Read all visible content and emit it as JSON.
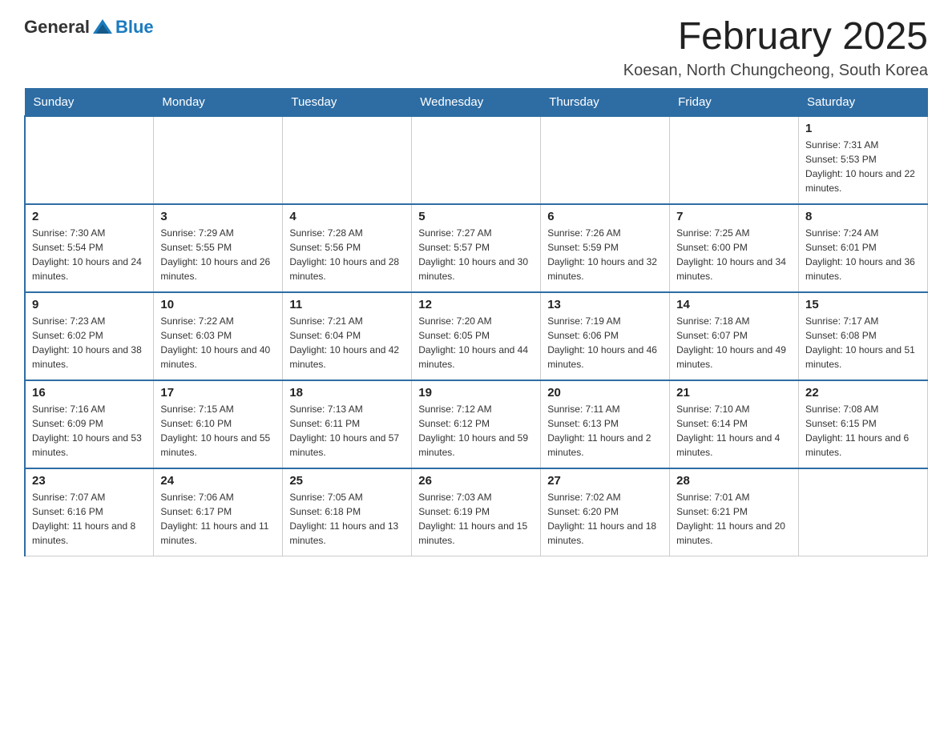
{
  "logo": {
    "text_general": "General",
    "text_blue": "Blue"
  },
  "header": {
    "title": "February 2025",
    "subtitle": "Koesan, North Chungcheong, South Korea"
  },
  "weekdays": [
    "Sunday",
    "Monday",
    "Tuesday",
    "Wednesday",
    "Thursday",
    "Friday",
    "Saturday"
  ],
  "weeks": [
    [
      {
        "day": "",
        "info": ""
      },
      {
        "day": "",
        "info": ""
      },
      {
        "day": "",
        "info": ""
      },
      {
        "day": "",
        "info": ""
      },
      {
        "day": "",
        "info": ""
      },
      {
        "day": "",
        "info": ""
      },
      {
        "day": "1",
        "info": "Sunrise: 7:31 AM\nSunset: 5:53 PM\nDaylight: 10 hours and 22 minutes."
      }
    ],
    [
      {
        "day": "2",
        "info": "Sunrise: 7:30 AM\nSunset: 5:54 PM\nDaylight: 10 hours and 24 minutes."
      },
      {
        "day": "3",
        "info": "Sunrise: 7:29 AM\nSunset: 5:55 PM\nDaylight: 10 hours and 26 minutes."
      },
      {
        "day": "4",
        "info": "Sunrise: 7:28 AM\nSunset: 5:56 PM\nDaylight: 10 hours and 28 minutes."
      },
      {
        "day": "5",
        "info": "Sunrise: 7:27 AM\nSunset: 5:57 PM\nDaylight: 10 hours and 30 minutes."
      },
      {
        "day": "6",
        "info": "Sunrise: 7:26 AM\nSunset: 5:59 PM\nDaylight: 10 hours and 32 minutes."
      },
      {
        "day": "7",
        "info": "Sunrise: 7:25 AM\nSunset: 6:00 PM\nDaylight: 10 hours and 34 minutes."
      },
      {
        "day": "8",
        "info": "Sunrise: 7:24 AM\nSunset: 6:01 PM\nDaylight: 10 hours and 36 minutes."
      }
    ],
    [
      {
        "day": "9",
        "info": "Sunrise: 7:23 AM\nSunset: 6:02 PM\nDaylight: 10 hours and 38 minutes."
      },
      {
        "day": "10",
        "info": "Sunrise: 7:22 AM\nSunset: 6:03 PM\nDaylight: 10 hours and 40 minutes."
      },
      {
        "day": "11",
        "info": "Sunrise: 7:21 AM\nSunset: 6:04 PM\nDaylight: 10 hours and 42 minutes."
      },
      {
        "day": "12",
        "info": "Sunrise: 7:20 AM\nSunset: 6:05 PM\nDaylight: 10 hours and 44 minutes."
      },
      {
        "day": "13",
        "info": "Sunrise: 7:19 AM\nSunset: 6:06 PM\nDaylight: 10 hours and 46 minutes."
      },
      {
        "day": "14",
        "info": "Sunrise: 7:18 AM\nSunset: 6:07 PM\nDaylight: 10 hours and 49 minutes."
      },
      {
        "day": "15",
        "info": "Sunrise: 7:17 AM\nSunset: 6:08 PM\nDaylight: 10 hours and 51 minutes."
      }
    ],
    [
      {
        "day": "16",
        "info": "Sunrise: 7:16 AM\nSunset: 6:09 PM\nDaylight: 10 hours and 53 minutes."
      },
      {
        "day": "17",
        "info": "Sunrise: 7:15 AM\nSunset: 6:10 PM\nDaylight: 10 hours and 55 minutes."
      },
      {
        "day": "18",
        "info": "Sunrise: 7:13 AM\nSunset: 6:11 PM\nDaylight: 10 hours and 57 minutes."
      },
      {
        "day": "19",
        "info": "Sunrise: 7:12 AM\nSunset: 6:12 PM\nDaylight: 10 hours and 59 minutes."
      },
      {
        "day": "20",
        "info": "Sunrise: 7:11 AM\nSunset: 6:13 PM\nDaylight: 11 hours and 2 minutes."
      },
      {
        "day": "21",
        "info": "Sunrise: 7:10 AM\nSunset: 6:14 PM\nDaylight: 11 hours and 4 minutes."
      },
      {
        "day": "22",
        "info": "Sunrise: 7:08 AM\nSunset: 6:15 PM\nDaylight: 11 hours and 6 minutes."
      }
    ],
    [
      {
        "day": "23",
        "info": "Sunrise: 7:07 AM\nSunset: 6:16 PM\nDaylight: 11 hours and 8 minutes."
      },
      {
        "day": "24",
        "info": "Sunrise: 7:06 AM\nSunset: 6:17 PM\nDaylight: 11 hours and 11 minutes."
      },
      {
        "day": "25",
        "info": "Sunrise: 7:05 AM\nSunset: 6:18 PM\nDaylight: 11 hours and 13 minutes."
      },
      {
        "day": "26",
        "info": "Sunrise: 7:03 AM\nSunset: 6:19 PM\nDaylight: 11 hours and 15 minutes."
      },
      {
        "day": "27",
        "info": "Sunrise: 7:02 AM\nSunset: 6:20 PM\nDaylight: 11 hours and 18 minutes."
      },
      {
        "day": "28",
        "info": "Sunrise: 7:01 AM\nSunset: 6:21 PM\nDaylight: 11 hours and 20 minutes."
      },
      {
        "day": "",
        "info": ""
      }
    ]
  ]
}
